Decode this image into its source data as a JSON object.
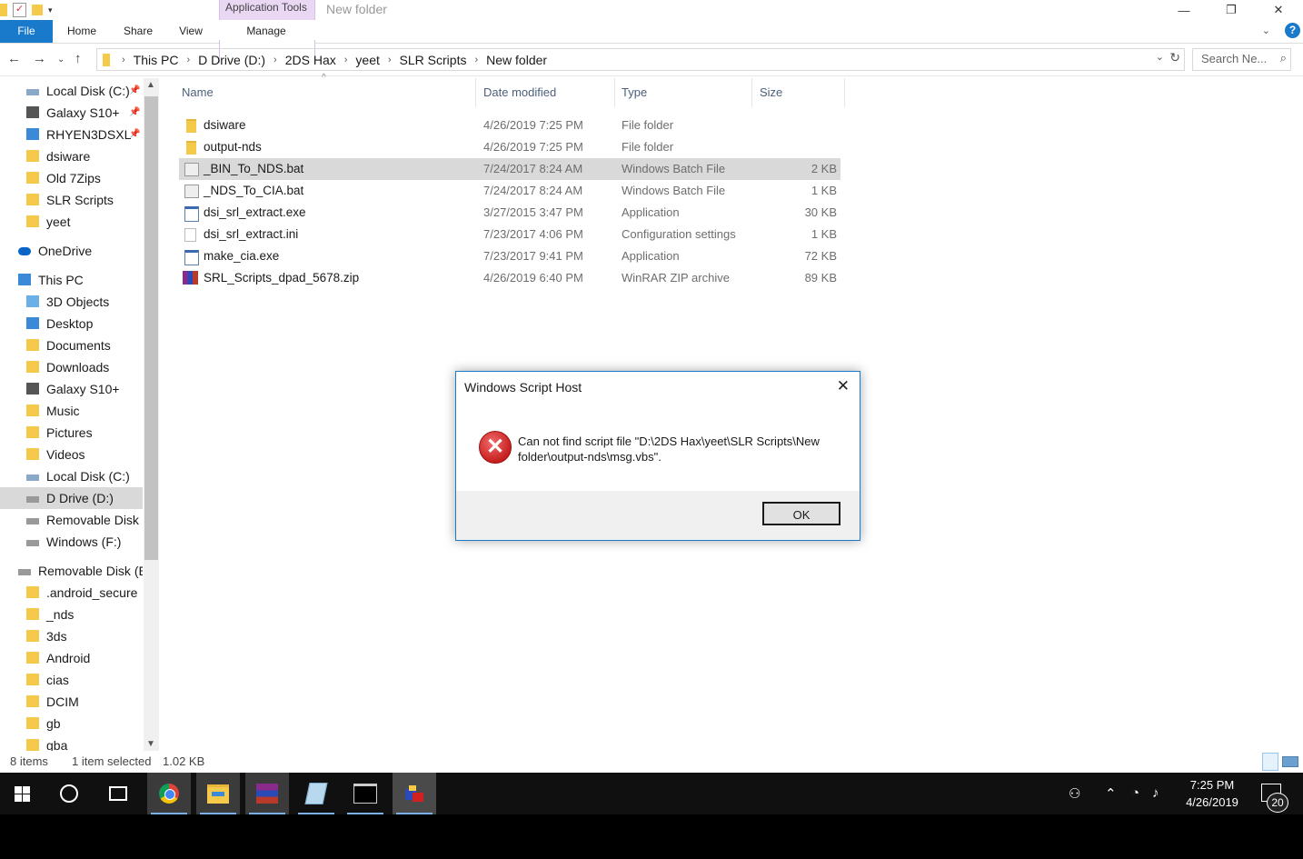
{
  "window": {
    "title": "New folder",
    "context_tab_label": "Application Tools",
    "minimize": "—",
    "restore": "❐",
    "close": "✕"
  },
  "ribbon": {
    "tabs": [
      "File",
      "Home",
      "Share",
      "View",
      "Manage"
    ],
    "help": "?"
  },
  "address": {
    "crumbs": [
      "This PC",
      "D Drive (D:)",
      "2DS Hax",
      "yeet",
      "SLR Scripts",
      "New folder"
    ],
    "search_placeholder": "Search Ne..."
  },
  "nav_pane": {
    "items": [
      {
        "label": "Local Disk (C:)",
        "icon": "local-disk-icon",
        "pinned": true
      },
      {
        "label": "Galaxy S10+",
        "icon": "phone-icon",
        "pinned": true
      },
      {
        "label": "RHYEN3DSXL",
        "icon": "network-pc-icon",
        "pinned": true
      },
      {
        "label": "dsiware",
        "icon": "folder-icon",
        "pinned": false
      },
      {
        "label": "Old 7Zips",
        "icon": "folder-icon",
        "pinned": false
      },
      {
        "label": "SLR Scripts",
        "icon": "folder-icon",
        "pinned": false
      },
      {
        "label": "yeet",
        "icon": "folder-icon",
        "pinned": false
      },
      {
        "label": "OneDrive",
        "icon": "onedrive-icon",
        "pinned": false
      },
      {
        "label": "This PC",
        "icon": "this-pc-icon",
        "pinned": false
      },
      {
        "label": "3D Objects",
        "icon": "3d-objects-icon",
        "pinned": false
      },
      {
        "label": "Desktop",
        "icon": "desktop-folder-icon",
        "pinned": false
      },
      {
        "label": "Documents",
        "icon": "documents-folder-icon",
        "pinned": false
      },
      {
        "label": "Downloads",
        "icon": "downloads-folder-icon",
        "pinned": false
      },
      {
        "label": "Galaxy S10+",
        "icon": "phone-icon",
        "pinned": false
      },
      {
        "label": "Music",
        "icon": "music-folder-icon",
        "pinned": false
      },
      {
        "label": "Pictures",
        "icon": "pictures-folder-icon",
        "pinned": false
      },
      {
        "label": "Videos",
        "icon": "videos-folder-icon",
        "pinned": false
      },
      {
        "label": "Local Disk (C:)",
        "icon": "local-disk-icon",
        "pinned": false
      },
      {
        "label": "D Drive (D:)",
        "icon": "drive-icon",
        "pinned": false
      },
      {
        "label": "Removable Disk (",
        "icon": "removable-disk-icon",
        "pinned": false
      },
      {
        "label": "Windows (F:)",
        "icon": "drive-icon",
        "pinned": false
      },
      {
        "label": "Removable Disk (E:",
        "icon": "removable-disk-icon",
        "pinned": false
      },
      {
        "label": ".android_secure",
        "icon": "folder-icon",
        "pinned": false
      },
      {
        "label": "_nds",
        "icon": "folder-icon",
        "pinned": false
      },
      {
        "label": "3ds",
        "icon": "folder-icon",
        "pinned": false
      },
      {
        "label": "Android",
        "icon": "folder-icon",
        "pinned": false
      },
      {
        "label": "cias",
        "icon": "folder-icon",
        "pinned": false
      },
      {
        "label": "DCIM",
        "icon": "folder-icon",
        "pinned": false
      },
      {
        "label": "gb",
        "icon": "folder-icon",
        "pinned": false
      },
      {
        "label": "gba",
        "icon": "folder-icon",
        "pinned": false
      }
    ]
  },
  "file_list": {
    "columns": [
      "Name",
      "Date modified",
      "Type",
      "Size"
    ],
    "rows": [
      {
        "name": "dsiware",
        "date": "4/26/2019 7:25 PM",
        "type": "File folder",
        "size": "",
        "icon": "folder-icon"
      },
      {
        "name": "output-nds",
        "date": "4/26/2019 7:25 PM",
        "type": "File folder",
        "size": "",
        "icon": "folder-icon"
      },
      {
        "name": "_BIN_To_NDS.bat",
        "date": "7/24/2017 8:24 AM",
        "type": "Windows Batch File",
        "size": "2 KB",
        "icon": "batch-file-icon"
      },
      {
        "name": "_NDS_To_CIA.bat",
        "date": "7/24/2017 8:24 AM",
        "type": "Windows Batch File",
        "size": "1 KB",
        "icon": "batch-file-icon"
      },
      {
        "name": "dsi_srl_extract.exe",
        "date": "3/27/2015 3:47 PM",
        "type": "Application",
        "size": "30 KB",
        "icon": "exe-file-icon"
      },
      {
        "name": "dsi_srl_extract.ini",
        "date": "7/23/2017 4:06 PM",
        "type": "Configuration settings",
        "size": "1 KB",
        "icon": "ini-file-icon"
      },
      {
        "name": "make_cia.exe",
        "date": "7/23/2017 9:41 PM",
        "type": "Application",
        "size": "72 KB",
        "icon": "exe-file-icon"
      },
      {
        "name": "SRL_Scripts_dpad_5678.zip",
        "date": "4/26/2019 6:40 PM",
        "type": "WinRAR ZIP archive",
        "size": "89 KB",
        "icon": "winrar-archive-icon"
      }
    ]
  },
  "status": {
    "count": "8 items",
    "selection": "1 item selected",
    "size": "1.02 KB"
  },
  "dialog": {
    "title": "Windows Script Host",
    "message": "Can not find script file \"D:\\2DS Hax\\yeet\\SLR Scripts\\New folder\\output-nds\\msg.vbs\".",
    "ok": "OK",
    "close": "✕"
  },
  "taskbar": {
    "time": "7:25 PM",
    "date": "4/26/2019",
    "notification_count": "20"
  },
  "colors": {
    "accent": "#1979ca",
    "context_tab": "#e9d7f4",
    "selection": "#d9d9d9",
    "folder": "#f5c94a",
    "error": "#c61f1f",
    "taskbar": "#101010"
  }
}
